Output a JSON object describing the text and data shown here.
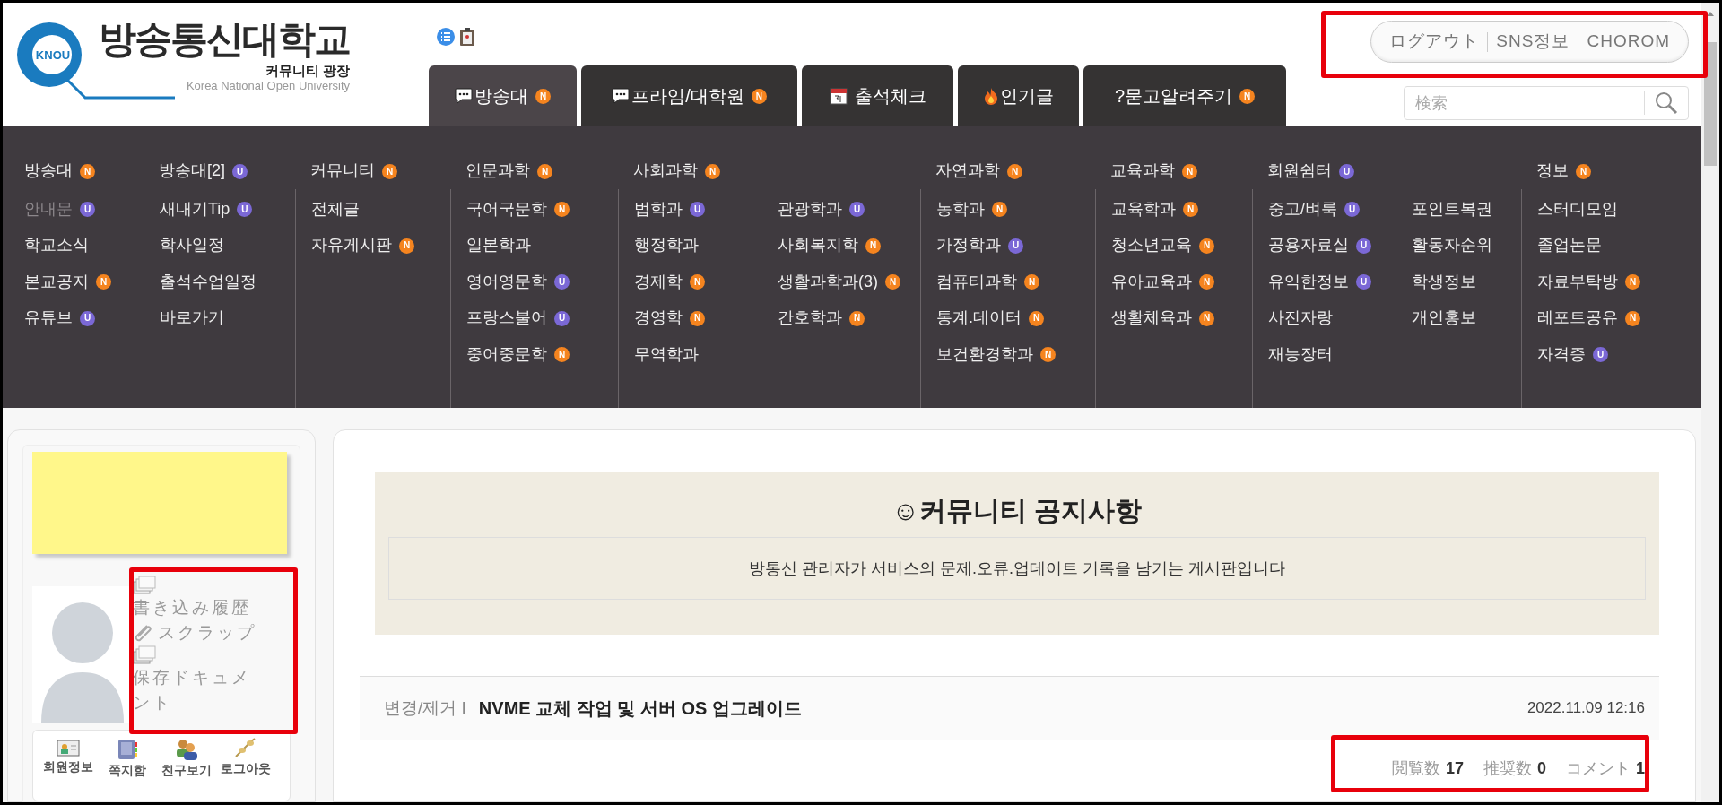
{
  "header": {
    "logo": {
      "badge": "KNOU",
      "title": "방송통신대학교",
      "subtitle": "커뮤니티 광장",
      "english": "Korea National Open University"
    },
    "tabs": [
      {
        "label": "방송대",
        "kind": "chat",
        "badge": {
          "text": "N",
          "color": "#f5841f"
        },
        "selected": true
      },
      {
        "label": "프라임/대학원",
        "kind": "chat",
        "badge": {
          "text": "N",
          "color": "#f5841f"
        },
        "selected": false
      },
      {
        "label": "출석체크",
        "kind": "calendar",
        "selected": false
      },
      {
        "label": "인기글",
        "kind": "fire",
        "selected": false
      },
      {
        "label": "?묻고알려주기",
        "kind": "plain",
        "badge": {
          "text": "N",
          "color": "#f5841f"
        },
        "selected": false
      }
    ],
    "account_links": [
      "ログアウト",
      "SNS정보",
      "CHOROM"
    ],
    "search": {
      "placeholder": "検索"
    }
  },
  "menu": {
    "groups": [
      {
        "heading": {
          "label": "방송대",
          "badge": {
            "text": "N",
            "color": "#f5841f"
          }
        },
        "columns": [
          [
            {
              "label": "안내문",
              "dimmed": true,
              "badge": {
                "text": "U",
                "color": "#7b68d6"
              }
            },
            {
              "label": "학교소식",
              "dimmed": false
            },
            {
              "label": "본교공지",
              "dimmed": false,
              "badge": {
                "text": "N",
                "color": "#f5841f"
              }
            },
            {
              "label": "유튜브",
              "dimmed": false,
              "badge": {
                "text": "U",
                "color": "#7b68d6"
              }
            }
          ]
        ]
      },
      {
        "heading": {
          "label": "방송대[2]",
          "badge": {
            "text": "U",
            "color": "#7b68d6"
          }
        },
        "columns": [
          [
            {
              "label": "새내기Tip",
              "dimmed": false,
              "badge": {
                "text": "U",
                "color": "#7b68d6"
              }
            },
            {
              "label": "학사일정",
              "dimmed": false
            },
            {
              "label": "출석수업일정",
              "dimmed": false
            },
            {
              "label": "바로가기",
              "dimmed": false
            }
          ]
        ]
      },
      {
        "heading": {
          "label": "커뮤니티",
          "badge": {
            "text": "N",
            "color": "#f5841f"
          }
        },
        "columns": [
          [
            {
              "label": "전체글",
              "dimmed": false
            },
            {
              "label": "자유게시판",
              "dimmed": false,
              "badge": {
                "text": "N",
                "color": "#f5841f"
              }
            }
          ]
        ]
      },
      {
        "heading": {
          "label": "인문과학",
          "badge": {
            "text": "N",
            "color": "#f5841f"
          }
        },
        "columns": [
          [
            {
              "label": "국어국문학",
              "dimmed": false,
              "badge": {
                "text": "N",
                "color": "#f5841f"
              }
            },
            {
              "label": "일본학과",
              "dimmed": false
            },
            {
              "label": "영어영문학",
              "dimmed": false,
              "badge": {
                "text": "U",
                "color": "#7b68d6"
              }
            },
            {
              "label": "프랑스불어",
              "dimmed": false,
              "badge": {
                "text": "U",
                "color": "#7b68d6"
              }
            },
            {
              "label": "중어중문학",
              "dimmed": false,
              "badge": {
                "text": "N",
                "color": "#f5841f"
              }
            }
          ]
        ]
      },
      {
        "heading": {
          "label": "사회과학",
          "badge": {
            "text": "N",
            "color": "#f5841f"
          }
        },
        "columns": [
          [
            {
              "label": "법학과",
              "dimmed": false,
              "badge": {
                "text": "U",
                "color": "#7b68d6"
              }
            },
            {
              "label": "행정학과",
              "dimmed": false
            },
            {
              "label": "경제학",
              "dimmed": false,
              "badge": {
                "text": "N",
                "color": "#f5841f"
              }
            },
            {
              "label": "경영학",
              "dimmed": false,
              "badge": {
                "text": "N",
                "color": "#f5841f"
              }
            },
            {
              "label": "무역학과",
              "dimmed": false
            }
          ],
          [
            {
              "label": "관광학과",
              "dimmed": false,
              "badge": {
                "text": "U",
                "color": "#7b68d6"
              }
            },
            {
              "label": "사회복지학",
              "dimmed": false,
              "badge": {
                "text": "N",
                "color": "#f5841f"
              }
            },
            {
              "label": "생활과학과(3)",
              "dimmed": false,
              "badge": {
                "text": "N",
                "color": "#f5841f"
              }
            },
            {
              "label": "간호학과",
              "dimmed": false,
              "badge": {
                "text": "N",
                "color": "#f5841f"
              }
            }
          ]
        ]
      },
      {
        "heading": {
          "label": "자연과학",
          "badge": {
            "text": "N",
            "color": "#f5841f"
          }
        },
        "columns": [
          [
            {
              "label": "농학과",
              "dimmed": false,
              "badge": {
                "text": "N",
                "color": "#f5841f"
              }
            },
            {
              "label": "가정학과",
              "dimmed": false,
              "badge": {
                "text": "U",
                "color": "#7b68d6"
              }
            },
            {
              "label": "컴퓨터과학",
              "dimmed": false,
              "badge": {
                "text": "N",
                "color": "#f5841f"
              }
            },
            {
              "label": "통계.데이터",
              "dimmed": false,
              "badge": {
                "text": "N",
                "color": "#f5841f"
              }
            },
            {
              "label": "보건환경학과",
              "dimmed": false,
              "badge": {
                "text": "N",
                "color": "#f5841f"
              }
            }
          ]
        ]
      },
      {
        "heading": {
          "label": "교육과학",
          "badge": {
            "text": "N",
            "color": "#f5841f"
          }
        },
        "columns": [
          [
            {
              "label": "교육학과",
              "dimmed": false,
              "badge": {
                "text": "N",
                "color": "#f5841f"
              }
            },
            {
              "label": "청소년교육",
              "dimmed": false,
              "badge": {
                "text": "N",
                "color": "#f5841f"
              }
            },
            {
              "label": "유아교육과",
              "dimmed": false,
              "badge": {
                "text": "N",
                "color": "#f5841f"
              }
            },
            {
              "label": "생활체육과",
              "dimmed": false,
              "badge": {
                "text": "N",
                "color": "#f5841f"
              }
            }
          ]
        ]
      },
      {
        "heading": {
          "label": "회원쉼터",
          "badge": {
            "text": "U",
            "color": "#7b68d6"
          }
        },
        "columns": [
          [
            {
              "label": "중고/벼룩",
              "dimmed": false,
              "badge": {
                "text": "U",
                "color": "#7b68d6"
              }
            },
            {
              "label": "공용자료실",
              "dimmed": false,
              "badge": {
                "text": "U",
                "color": "#7b68d6"
              }
            },
            {
              "label": "유익한정보",
              "dimmed": false,
              "badge": {
                "text": "U",
                "color": "#7b68d6"
              }
            },
            {
              "label": "사진자랑",
              "dimmed": false
            },
            {
              "label": "재능장터",
              "dimmed": false
            }
          ],
          [
            {
              "label": "포인트복권",
              "dimmed": false
            },
            {
              "label": "활동자순위",
              "dimmed": false
            },
            {
              "label": "학생정보",
              "dimmed": false
            },
            {
              "label": "개인홍보",
              "dimmed": false
            }
          ]
        ]
      },
      {
        "heading": {
          "label": "정보",
          "badge": {
            "text": "N",
            "color": "#f5841f"
          }
        },
        "columns": [
          [
            {
              "label": "스터디모임",
              "dimmed": false
            },
            {
              "label": "졸업논문",
              "dimmed": false
            },
            {
              "label": "자료부탁방",
              "dimmed": false,
              "badge": {
                "text": "N",
                "color": "#f5841f"
              }
            },
            {
              "label": "레포트공유",
              "dimmed": false,
              "badge": {
                "text": "N",
                "color": "#f5841f"
              }
            },
            {
              "label": "자격증",
              "dimmed": false,
              "badge": {
                "text": "U",
                "color": "#7b68d6"
              }
            }
          ]
        ]
      }
    ]
  },
  "sidebar": {
    "links": [
      {
        "label": "書き込み履歴",
        "kind": "pages"
      },
      {
        "label": "スクラップ",
        "kind": "clip"
      },
      {
        "label": "保存ドキュメント",
        "kind": "pages"
      }
    ],
    "buttons": [
      {
        "label": "회원정보",
        "kind": "card"
      },
      {
        "label": "쪽지함",
        "kind": "book"
      },
      {
        "label": "친구보기",
        "kind": "people"
      },
      {
        "label": "로그아웃",
        "kind": "plug"
      }
    ]
  },
  "board": {
    "title": "☺커뮤니티 공지사항",
    "description": "방통신 관리자가 서비스의 문제.오류.업데이트 기록을 남기는 게시판입니다",
    "posts": [
      {
        "category": "변경/제거 I",
        "title": "NVME 교체 작업 및 서버 OS 업그레이드",
        "date": "2022.11.09 12:16"
      }
    ],
    "stats": [
      {
        "label": "閲覧数",
        "value": "17"
      },
      {
        "label": "推奨数",
        "value": "0"
      },
      {
        "label": "コメント",
        "value": "1"
      }
    ]
  }
}
